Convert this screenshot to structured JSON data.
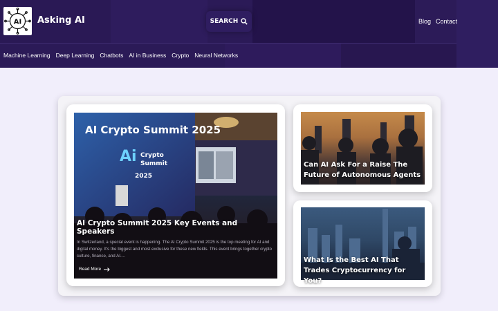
{
  "header": {
    "site_title": "Asking AI",
    "logo_text": "AI",
    "search_label": "SEARCH",
    "nav_links": [
      "Blog",
      "Contact"
    ]
  },
  "categories": [
    "Machine Learning",
    "Deep Learning",
    "Chatbots",
    "AI in Business",
    "Crypto",
    "Neural Networks"
  ],
  "featured": {
    "image_text": [
      "AI Crypto Summit 2025",
      "Crypto",
      "Summit",
      "2025"
    ],
    "title": "AI Crypto Summit 2025 Key Events and Speakers",
    "excerpt": "In Switzerland, a special event is happening. The AI Crypto Summit 2025 is the top meeting for AI and digital money. It's the biggest and most exclusive for these new fields. This event brings together crypto culture, finance, and AI....",
    "read_more": "Read More"
  },
  "side_posts": [
    {
      "title": "Can AI Ask For a Raise The Future of Autonomous Agents"
    },
    {
      "title": "What Is the Best AI That Trades Cryptocurrency for You?"
    }
  ],
  "colors": {
    "header_bg": "#24144a",
    "page_bg": "#f1eefb",
    "card_bg": "#ffffff"
  }
}
